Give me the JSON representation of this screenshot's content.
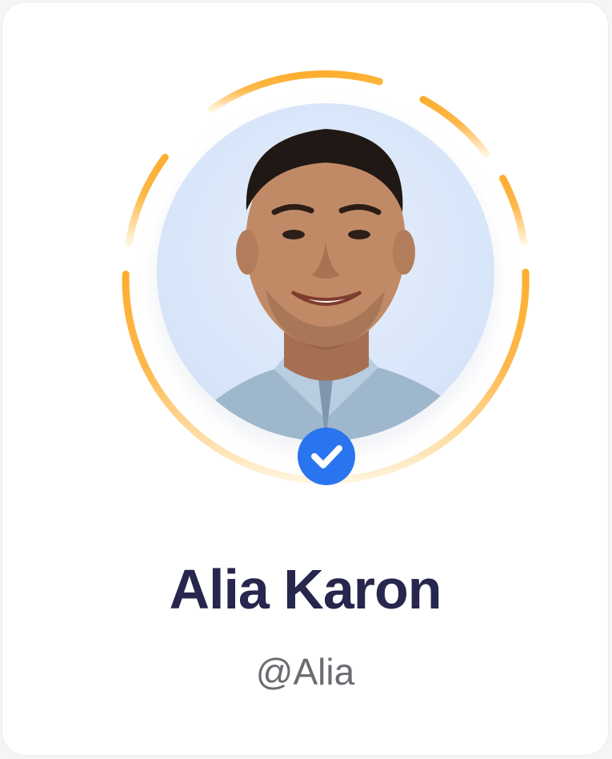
{
  "profile": {
    "name": "Alia Karon",
    "handle": "@Alia",
    "verified": true,
    "avatar_icon": "person-avatar",
    "verified_icon": "check-badge-icon"
  },
  "colors": {
    "ring_strong": "#fdae2f",
    "ring_faded": "#fff4dc",
    "avatar_bg": "#dce8fb",
    "badge": "#2a74ef",
    "name_text": "#27264d",
    "handle_text": "#6b6b72"
  }
}
